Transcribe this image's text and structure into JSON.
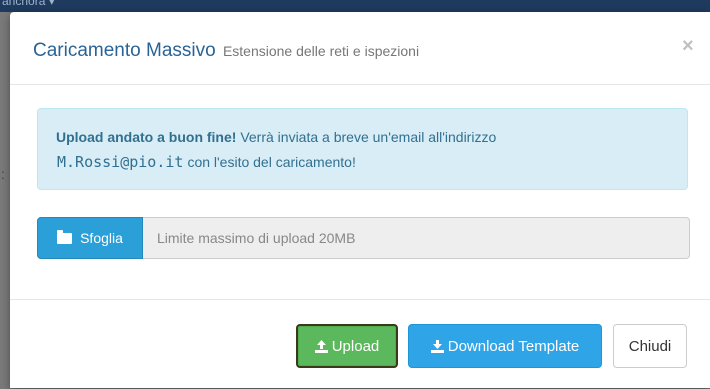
{
  "background": {
    "topbar_label": "anchora ▾"
  },
  "modal": {
    "title": "Caricamento Massivo",
    "subtitle": "Estensione delle reti e ispezioni",
    "close_symbol": "×"
  },
  "alert": {
    "bold_text": "Upload andato a buon fine!",
    "text_part1": " Verrà inviata a breve un'email all'indirizzo",
    "email": "M.Rossi@pio.it",
    "text_part2": "con l'esito del caricamento!"
  },
  "upload": {
    "browse_label": "Sfoglia",
    "browse_icon": "folder-open-icon",
    "placeholder": "Limite massimo di upload 20MB"
  },
  "footer": {
    "upload_label": "Upload",
    "upload_icon": "upload-icon",
    "download_label": "Download Template",
    "download_icon": "download-icon",
    "close_label": "Chiudi"
  },
  "colors": {
    "title": "#2a6496",
    "alert_bg": "#d9edf7",
    "alert_text": "#31708f",
    "primary": "#2fa4e7",
    "success": "#5cb85c"
  }
}
